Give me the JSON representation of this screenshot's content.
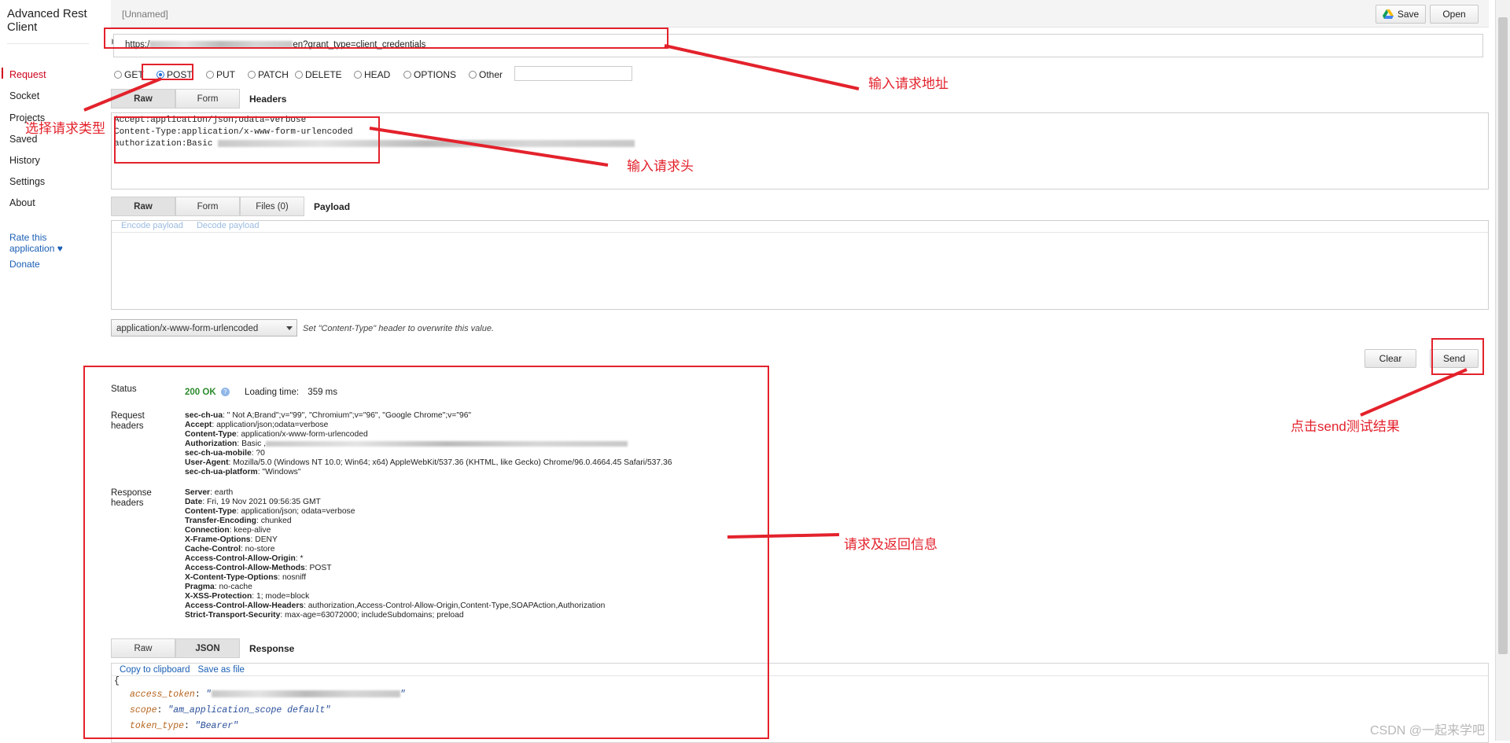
{
  "sidebar": {
    "app_title": "Advanced Rest Client",
    "items": [
      "Request",
      "Socket",
      "Projects",
      "Saved",
      "History",
      "Settings",
      "About"
    ],
    "rate_link": "Rate this application ♥",
    "donate_link": "Donate"
  },
  "topbar": {
    "doc_name": "[Unnamed]",
    "save_label": "Save",
    "open_label": "Open"
  },
  "url": {
    "prefix": "https:/",
    "suffix": "en?grant_type=client_credentials"
  },
  "methods": [
    "GET",
    "POST",
    "PUT",
    "PATCH",
    "DELETE",
    "HEAD",
    "OPTIONS",
    "Other"
  ],
  "selected_method": "POST",
  "headers_tabs": {
    "raw": "Raw",
    "form": "Form",
    "title": "Headers"
  },
  "headers_text": [
    "Accept:application/json;odata=verbose",
    "Content-Type:application/x-www-form-urlencoded",
    "authorization:Basic"
  ],
  "payload_tabs": {
    "raw": "Raw",
    "form": "Form",
    "files": "Files (0)",
    "title": "Payload"
  },
  "payload_links": {
    "encode": "Encode payload",
    "decode": "Decode payload"
  },
  "content_type": {
    "selected": "application/x-www-form-urlencoded",
    "hint": "Set \"Content-Type\" header to overwrite this value."
  },
  "actions": {
    "clear": "Clear",
    "send": "Send"
  },
  "status": {
    "label": "Status",
    "code": "200 OK",
    "loading_label": "Loading time:",
    "loading_value": "359 ms"
  },
  "request_headers": {
    "label": "Request headers",
    "rows": [
      {
        "k": "sec-ch-ua",
        "v": ": \" Not A;Brand\";v=\"99\", \"Chromium\";v=\"96\", \"Google Chrome\";v=\"96\""
      },
      {
        "k": "Accept",
        "v": ": application/json;odata=verbose"
      },
      {
        "k": "Content-Type",
        "v": ": application/x-www-form-urlencoded"
      },
      {
        "k": "Authorization",
        "v": ": Basic ,"
      },
      {
        "k": "sec-ch-ua-mobile",
        "v": ": ?0"
      },
      {
        "k": "User-Agent",
        "v": ": Mozilla/5.0 (Windows NT 10.0; Win64; x64) AppleWebKit/537.36 (KHTML, like Gecko) Chrome/96.0.4664.45 Safari/537.36"
      },
      {
        "k": "sec-ch-ua-platform",
        "v": ": \"Windows\""
      }
    ]
  },
  "response_headers": {
    "label": "Response headers",
    "rows": [
      {
        "k": "Server",
        "v": ": earth"
      },
      {
        "k": "Date",
        "v": ": Fri, 19 Nov 2021 09:56:35 GMT"
      },
      {
        "k": "Content-Type",
        "v": ": application/json; odata=verbose"
      },
      {
        "k": "Transfer-Encoding",
        "v": ": chunked"
      },
      {
        "k": "Connection",
        "v": ": keep-alive"
      },
      {
        "k": "X-Frame-Options",
        "v": ": DENY"
      },
      {
        "k": "Cache-Control",
        "v": ": no-store"
      },
      {
        "k": "Access-Control-Allow-Origin",
        "v": ": *"
      },
      {
        "k": "Access-Control-Allow-Methods",
        "v": ": POST"
      },
      {
        "k": "X-Content-Type-Options",
        "v": ": nosniff"
      },
      {
        "k": "Pragma",
        "v": ": no-cache"
      },
      {
        "k": "X-XSS-Protection",
        "v": ": 1; mode=block"
      },
      {
        "k": "Access-Control-Allow-Headers",
        "v": ": authorization,Access-Control-Allow-Origin,Content-Type,SOAPAction,Authorization"
      },
      {
        "k": "Strict-Transport-Security",
        "v": ": max-age=63072000; includeSubdomains; preload"
      }
    ]
  },
  "response_tabs": {
    "raw": "Raw",
    "json": "JSON",
    "title": "Response"
  },
  "response_tools": {
    "copy": "Copy to clipboard",
    "save": "Save as file"
  },
  "json": {
    "open": "{",
    "k1": "access_token",
    "v1": "\"",
    "k2": "scope",
    "v2": "\"am_application_scope default\"",
    "k3": "token_type",
    "v3": "\"Bearer\""
  },
  "annotations": {
    "url": "输入请求地址",
    "method": "选择请求类型",
    "headers": "输入请求头",
    "send": "点击send测试结果",
    "info": "请求及返回信息"
  },
  "watermark": "CSDN @一起来学吧",
  "colors": {
    "annotation": "#e3222c",
    "status_ok": "#2e8b2e",
    "link": "#1a5fb4"
  }
}
